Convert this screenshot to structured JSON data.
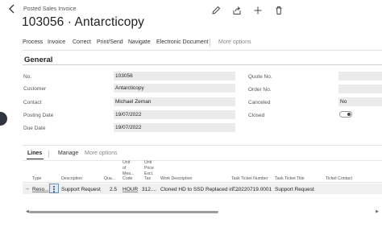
{
  "header": {
    "breadcrumb": "Posted Sales Invoice",
    "title": "103056 · Antarcticopy"
  },
  "toolbar_icons": [
    "edit-icon",
    "share-icon",
    "add-icon",
    "delete-icon"
  ],
  "actions": [
    "Process",
    "Invoice",
    "Correct",
    "Print/Send",
    "Navigate",
    "Electronic Document",
    "More options"
  ],
  "general": {
    "title": "General",
    "left": [
      {
        "label": "No.",
        "value": "103056"
      },
      {
        "label": "Customer",
        "value": "Antarcticopy"
      },
      {
        "label": "Contact",
        "value": "Michael Zeman"
      },
      {
        "label": "Posting Date",
        "value": "19/07/2022"
      },
      {
        "label": "Due Date",
        "value": "19/07/2022"
      }
    ],
    "right": [
      {
        "label": "Quote No.",
        "value": ""
      },
      {
        "label": "Order No.",
        "value": ""
      },
      {
        "label": "Canceled",
        "value": "No"
      },
      {
        "label": "Closed",
        "value": ""
      }
    ],
    "closed_toggle_on": false
  },
  "lines": {
    "tab": "Lines",
    "manage": "Manage",
    "more": "More options",
    "columns": [
      "Type",
      "Description",
      "Qua...",
      "Unit\nof\nMea...\nCode",
      "Unit\nPrice\nExcl.\nTax",
      "Work Description",
      "Task Ticket Number",
      "Task Ticket Title",
      "Ticket Contact"
    ],
    "row": {
      "type": "Reso...",
      "description": "Support Request",
      "quantity": "2.5",
      "uom": "HOUR",
      "unit_price": "312....",
      "work_description": "Cloned HD to SSD Replaced in ...",
      "ticket_number": "T20220719.0001",
      "ticket_title": "Support Request",
      "ticket_contact": ""
    }
  },
  "colors": {
    "field_bg": "#ebebeb",
    "row_bg": "#f0f0f0",
    "accent": "#6b8db5"
  }
}
